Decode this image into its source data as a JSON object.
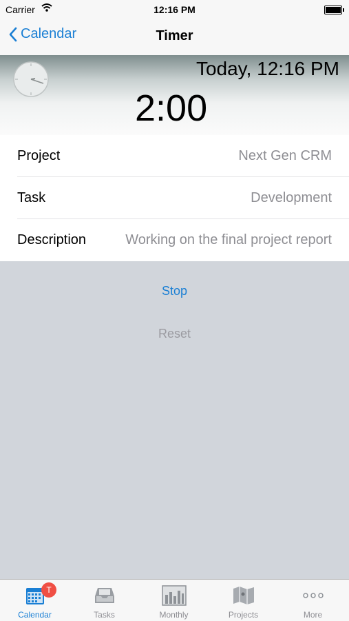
{
  "status_bar": {
    "carrier": "Carrier",
    "time": "12:16 PM"
  },
  "nav": {
    "back_label": "Calendar",
    "title": "Timer"
  },
  "timer": {
    "today": "Today, 12:16 PM",
    "elapsed": "2:00"
  },
  "fields": [
    {
      "label": "Project",
      "value": "Next Gen CRM"
    },
    {
      "label": "Task",
      "value": "Development"
    },
    {
      "label": "Description",
      "value": "Working on the final project report"
    }
  ],
  "actions": {
    "stop": "Stop",
    "reset": "Reset"
  },
  "tabbar": {
    "tabs": [
      {
        "label": "Calendar",
        "icon": "calendar-icon",
        "badge": "T"
      },
      {
        "label": "Tasks",
        "icon": "inbox-tray-icon"
      },
      {
        "label": "Monthly",
        "icon": "bar-chart-icon"
      },
      {
        "label": "Projects",
        "icon": "map-icon"
      },
      {
        "label": "More",
        "icon": "more-dots-icon"
      }
    ]
  },
  "colors": {
    "accent": "#1a7fd4",
    "badge": "#f04f44",
    "background": "#d1d5db"
  }
}
